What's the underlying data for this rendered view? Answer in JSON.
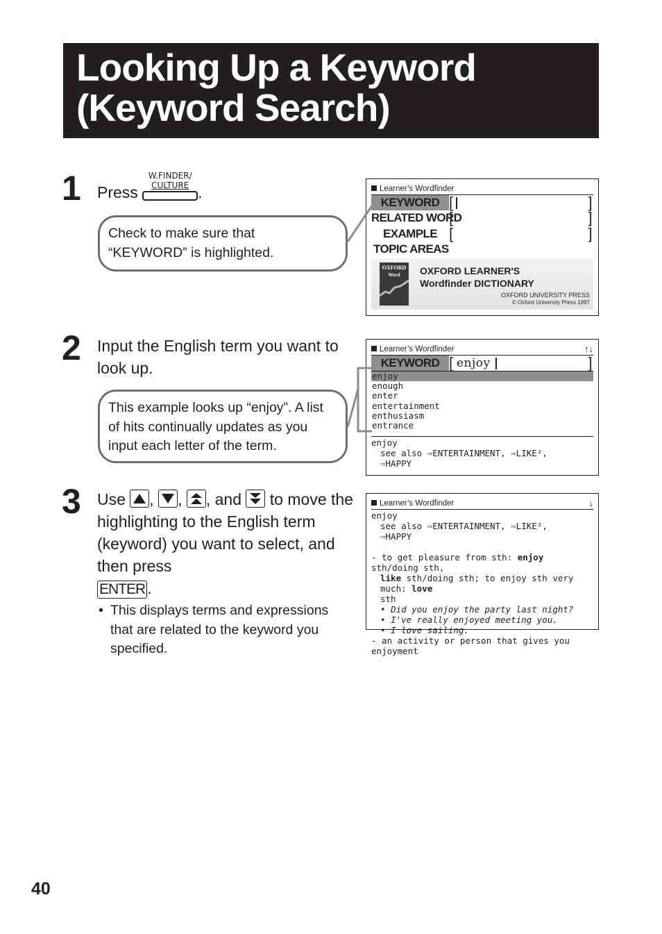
{
  "title": {
    "line1": "Looking Up a Keyword",
    "line2": "(Keyword Search)"
  },
  "steps": [
    {
      "number": "1",
      "text_before": "Press",
      "key": {
        "top": "W.FINDER/",
        "bottom": "CULTURE",
        "icon": "w-finder-culture-key-icon"
      },
      "text_after": ".",
      "bubble": "Check to make sure that “KEYWORD” is highlighted."
    },
    {
      "number": "2",
      "text": "Input the English term you want to look up.",
      "bubble": "This example looks up “enjoy”. A list of hits continually updates as you input each letter of the term."
    },
    {
      "number": "3",
      "parts": {
        "use": "Use",
        "comma1": ",",
        "comma2": ",",
        "and": ", and",
        "rest": "to move the highlighting to the English term (keyword) you want to select, and then press",
        "period": "."
      },
      "keys": [
        "up-arrow-key-icon",
        "down-arrow-key-icon",
        "page-up-key-icon",
        "page-down-key-icon"
      ],
      "enter_key": "ENTER",
      "note": "This displays terms and expressions that are related to the keyword you specified."
    }
  ],
  "screens": {
    "screen1": {
      "header": "Learner’s Wordfinder",
      "fields": [
        {
          "label": "KEYWORD",
          "highlighted": true,
          "value": ""
        },
        {
          "label": "RELATED WORD",
          "highlighted": false,
          "value": ""
        },
        {
          "label": "EXAMPLE",
          "highlighted": false,
          "value": ""
        },
        {
          "label": "TOPIC AREAS",
          "highlighted": false
        }
      ],
      "banner": {
        "book_title": "OXFORD",
        "book_sub": "Word",
        "line1": "OXFORD LEARNER'S",
        "line2": "Wordfinder DICTIONARY",
        "publisher": "OXFORD UNIVERSITY PRESS",
        "copyright": "© Oxford University Press 1997"
      }
    },
    "screen2": {
      "header": "Learner’s Wordfinder",
      "scroll_arrows": "↑↓",
      "keyword_label": "KEYWORD",
      "keyword_value": "enjoy",
      "hits": [
        "enjoy",
        "enough",
        "enter",
        "entertainment",
        "enthusiasm",
        "entrance"
      ],
      "selected_index": 0,
      "preview": {
        "headword": "enjoy",
        "see_also": "see also ⇨ENTERTAINMENT, ⇨LIKE²,",
        "see_also_2": "⇨HAPPY"
      }
    },
    "screen3": {
      "header": "Learner’s Wordfinder",
      "scroll_arrow": "↓",
      "headword": "enjoy",
      "see_also": "see also ⇨ENTERTAINMENT, ⇨LIKE²,",
      "see_also_2": "⇨HAPPY",
      "def1_a": "- to get pleasure from sth: ",
      "def1_b": "enjoy",
      "def1_c": " sth/doing sth,",
      "def1_d": "like",
      "def1_e": " sth/doing sth; to enjoy sth very much: ",
      "def1_f": "love",
      "def1_g": "sth",
      "examples": [
        "Did you enjoy the party last night?",
        "I've really enjoyed meeting you.",
        "I love sailing."
      ],
      "def2": "- an activity or person that gives you enjoyment"
    }
  },
  "page_number": "40"
}
